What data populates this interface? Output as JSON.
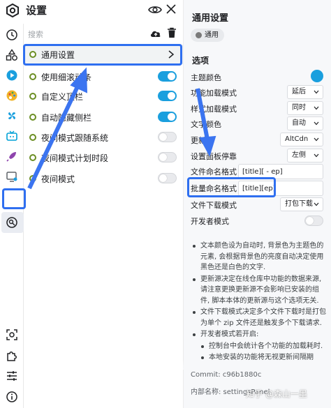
{
  "header": {
    "title": "设置"
  },
  "search": {
    "placeholder": "搜索"
  },
  "menu": {
    "items": [
      {
        "label": "通用设置",
        "toggle": null,
        "selected": true
      },
      {
        "label": "使用细滚动条",
        "toggle": "on"
      },
      {
        "label": "自定义顶栏",
        "toggle": "on"
      },
      {
        "label": "自动隐藏侧栏",
        "toggle": "on"
      },
      {
        "label": "夜间模式跟随系统",
        "toggle": "off"
      },
      {
        "label": "夜间模式计划时段",
        "toggle": "off"
      },
      {
        "label": "夜间模式",
        "toggle": "off"
      }
    ]
  },
  "rail_icons": [
    "clock-icon",
    "shapes-icon",
    "play-icon",
    "palette-icon",
    "pinwheel-icon",
    "tv-icon",
    "rocket-icon",
    "screenshot-icon",
    "settings-search-icon",
    "capture-icon",
    "puzzle-icon",
    "sliders-icon",
    "info-icon"
  ],
  "detail": {
    "title": "通用设置",
    "chip": "通用",
    "section": "选项",
    "options": {
      "theme_color": {
        "label": "主题颜色",
        "value": "#1a9fde"
      },
      "perf_mode": {
        "label": "功能加载模式",
        "value": "延后"
      },
      "style_mode": {
        "label": "样式加载模式",
        "value": "同时"
      },
      "text_color": {
        "label": "文字颜色",
        "value": "自动"
      },
      "update_source": {
        "label": "更新源",
        "value": "AltCdn"
      },
      "dock": {
        "label": "设置面板停靠",
        "value": "左侧"
      },
      "file_name": {
        "label": "文件命名格式",
        "value": "[title][ - ep]"
      },
      "batch_name": {
        "label": "批量命名格式",
        "value": "[title][ep]"
      },
      "download_mode": {
        "label": "文件下载模式",
        "value": "打包下载"
      },
      "dev_mode": {
        "label": "开发者模式",
        "value": "off"
      }
    },
    "notes": [
      "文本颜色设为自动时, 背景色为主题色的元素, 会根据背景色的亮度自动决定使用黑色还是白色的文字.",
      "更新源决定在线仓库中功能的数据来源, 请注意更换更新源不会影响已安装的组件, 脚本本体的更新源与这个选项无关.",
      "文件下载模式决定多个文件下载时是打包为单个 zip 文件还是触发多个下载请求.",
      "开发者模式若开启:",
      "控制台中会统计各个功能的加载耗时.",
      "本地安装的功能将无视更新间隔期"
    ],
    "commit": "Commit: c96b1880c",
    "internal_name": "内部名称: settingsPanel"
  },
  "watermark": "知乎 @森山一墨",
  "colors": {
    "accent": "#1a9fde",
    "annotation": "#2f6ff0",
    "dot": "#6b8e23"
  }
}
